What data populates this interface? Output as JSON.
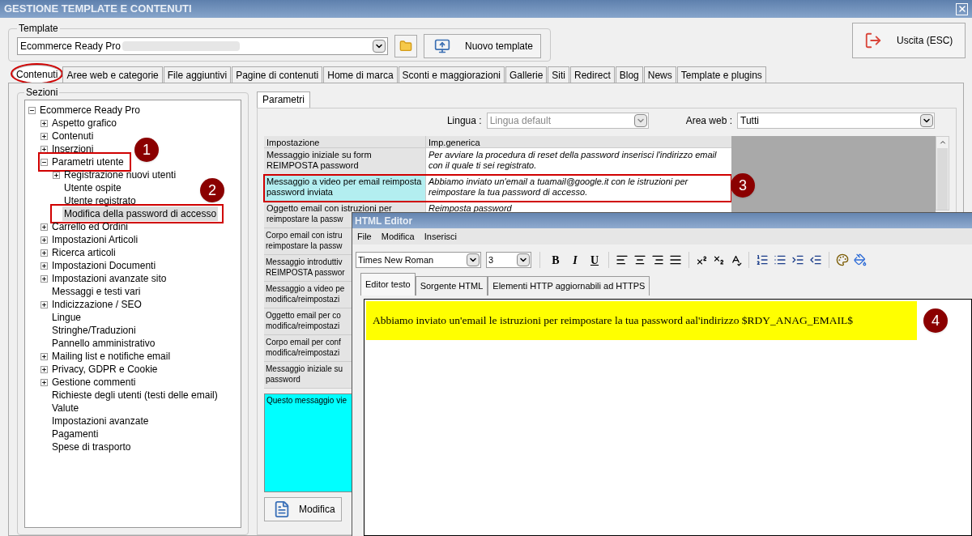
{
  "window": {
    "title": "GESTIONE TEMPLATE E CONTENUTI"
  },
  "template": {
    "label": "Template",
    "value": "Ecommerce Ready Pro",
    "new_button": "Nuovo template"
  },
  "exit_button": "Uscita (ESC)",
  "tabs": [
    {
      "label": "Contenuti",
      "selected": true,
      "circled": true
    },
    {
      "label": "Aree web e categorie",
      "selected": false,
      "circled": false
    },
    {
      "label": "File aggiuntivi",
      "selected": false,
      "circled": false
    },
    {
      "label": "Pagine di contenuti",
      "selected": false,
      "circled": false
    },
    {
      "label": "Home di marca",
      "selected": false,
      "circled": false
    },
    {
      "label": "Sconti e maggiorazioni",
      "selected": false,
      "circled": false
    },
    {
      "label": "Gallerie",
      "selected": false,
      "circled": false
    },
    {
      "label": "Siti",
      "selected": false,
      "circled": false
    },
    {
      "label": "Redirect",
      "selected": false,
      "circled": false
    },
    {
      "label": "Blog",
      "selected": false,
      "circled": false
    },
    {
      "label": "News",
      "selected": false,
      "circled": false
    },
    {
      "label": "Template e plugins",
      "selected": false,
      "circled": false
    }
  ],
  "sections": {
    "label": "Sezioni",
    "tree": [
      {
        "label": "Ecommerce Ready Pro",
        "expanded": true,
        "selected": false,
        "highlighted": false,
        "children": [
          {
            "label": "Aspetto grafico",
            "expanded": false,
            "selected": false,
            "highlighted": false
          },
          {
            "label": "Contenuti",
            "expanded": false,
            "selected": false,
            "highlighted": false
          },
          {
            "label": "Inserzioni",
            "expanded": false,
            "selected": false,
            "highlighted": false
          },
          {
            "label": "Parametri utente",
            "expanded": true,
            "selected": false,
            "highlighted": true,
            "children": [
              {
                "label": "Registrazione nuovi utenti",
                "expanded": false,
                "selected": false,
                "highlighted": false
              },
              {
                "label": "Utente ospite",
                "selected": false,
                "highlighted": false
              },
              {
                "label": "Utente registrato",
                "selected": false,
                "highlighted": false
              },
              {
                "label": "Modifica della password di accesso",
                "selected": true,
                "highlighted": true
              }
            ]
          },
          {
            "label": "Carrello ed Ordini",
            "expanded": false,
            "selected": false,
            "highlighted": false
          },
          {
            "label": "Impostazioni Articoli",
            "expanded": false,
            "selected": false,
            "highlighted": false
          },
          {
            "label": "Ricerca articoli",
            "expanded": false,
            "selected": false,
            "highlighted": false
          },
          {
            "label": "Impostazioni Documenti",
            "expanded": false,
            "selected": false,
            "highlighted": false
          },
          {
            "label": "Impostazioni avanzate sito",
            "expanded": false,
            "selected": false,
            "highlighted": false
          },
          {
            "label": "Messaggi e testi vari",
            "selected": false,
            "highlighted": false
          },
          {
            "label": "Indicizzazione / SEO",
            "expanded": false,
            "selected": false,
            "highlighted": false
          },
          {
            "label": "Lingue",
            "selected": false,
            "highlighted": false
          },
          {
            "label": "Stringhe/Traduzioni",
            "selected": false,
            "highlighted": false
          },
          {
            "label": "Pannello amministrativo",
            "selected": false,
            "highlighted": false
          },
          {
            "label": "Mailing list e notifiche email",
            "expanded": false,
            "selected": false,
            "highlighted": false
          },
          {
            "label": "Privacy, GDPR e Cookie",
            "expanded": false,
            "selected": false,
            "highlighted": false
          },
          {
            "label": "Gestione commenti",
            "expanded": false,
            "selected": false,
            "highlighted": false
          },
          {
            "label": "Richieste degli utenti (testi delle email)",
            "selected": false,
            "highlighted": false
          },
          {
            "label": "Valute",
            "selected": false,
            "highlighted": false
          },
          {
            "label": "Impostazioni avanzate",
            "selected": false,
            "highlighted": false
          },
          {
            "label": "Pagamenti",
            "selected": false,
            "highlighted": false
          },
          {
            "label": "Spese di trasporto",
            "selected": false,
            "highlighted": false
          }
        ]
      }
    ]
  },
  "params": {
    "tab": "Parametri",
    "language_label": "Lingua :",
    "language_placeholder": "Lingua default",
    "area_label": "Area web :",
    "area_value": "Tutti",
    "columns": [
      "Impostazione",
      "Imp.generica"
    ],
    "rows": [
      {
        "setting": "Messaggio iniziale su form REIMPOSTA password",
        "value": "Per avviare la procedura di reset della password inserisci l'indirizzo email con il quale ti sei registrato.",
        "selected": false,
        "highlighted": false
      },
      {
        "setting": "Messaggio a video per email reimposta password inviata",
        "value": "Abbiamo inviato un'email a tuamail@google.it con le istruzioni per reimpostare la tua password di accesso.",
        "selected": true,
        "highlighted": true
      },
      {
        "setting_lines": [
          "Oggetto email con istruzioni per",
          "reimpostare la passw"
        ],
        "value": "Reimposta password",
        "selected": false,
        "highlighted": false
      }
    ],
    "covered_rows": [
      [
        "Corpo email con istru",
        "reimpostare la passw"
      ],
      [
        "Messaggio introduttiv",
        "REIMPOSTA passwor"
      ],
      [
        "Messaggio a video pe",
        "modifica/reimpostazi"
      ],
      [
        "Oggetto email per co",
        "modifica/reimpostazi"
      ],
      [
        "Corpo email per conf",
        "modifica/reimpostazi"
      ],
      [
        "Messaggio iniziale su",
        "password"
      ]
    ],
    "description": "Questo messaggio vie",
    "edit_button": "Modifica"
  },
  "editor": {
    "title": "HTML Editor",
    "menu": [
      "File",
      "Modifica",
      "Inserisci"
    ],
    "font": "Times New Roman",
    "size": "3",
    "format_buttons": [
      "B",
      "I",
      "U"
    ],
    "tabs": [
      {
        "label": "Editor testo",
        "selected": true
      },
      {
        "label": "Sorgente HTML",
        "selected": false
      },
      {
        "label": "Elementi HTTP aggiornabili ad HTTPS",
        "selected": false
      }
    ],
    "content": "Abbiamo inviato un'email le istruzioni per reimpostare la tua password aal'indirizzo $RDY_ANAG_EMAIL$"
  },
  "markers": [
    "1",
    "2",
    "3",
    "4"
  ]
}
